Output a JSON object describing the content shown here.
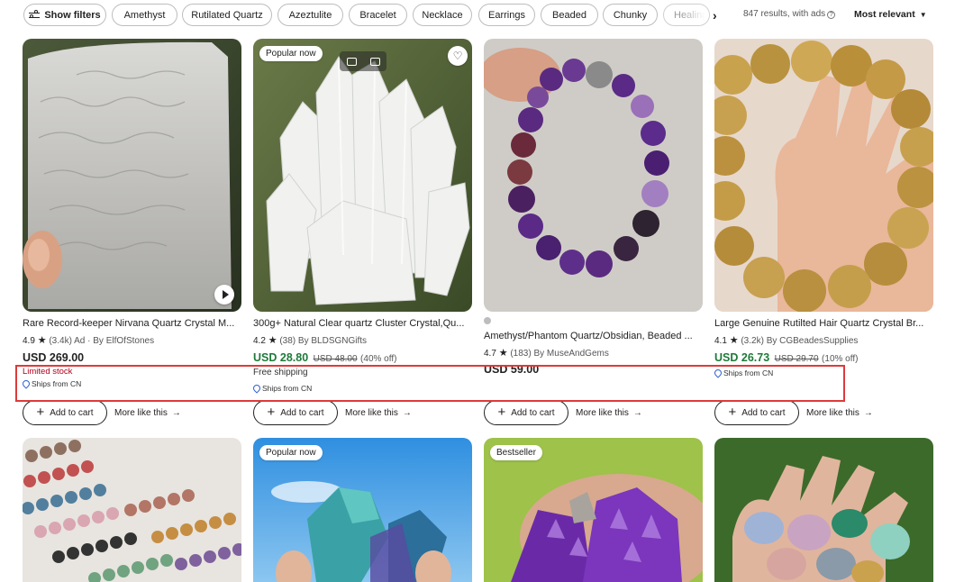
{
  "filters": {
    "show_filters": "Show filters",
    "chips": [
      "Amethyst",
      "Rutilated Quartz",
      "Azeztulite",
      "Bracelet",
      "Necklace",
      "Earrings",
      "Beaded",
      "Chunky",
      "Healing"
    ],
    "results": "847 results, with ads",
    "sort": "Most relevant"
  },
  "actions": {
    "add_to_cart": "Add to cart",
    "more_like_this": "More like this"
  },
  "listings": [
    {
      "title": "Rare Record-keeper Nirvana Quartz Crystal M...",
      "score": "4.9",
      "reviews": "(3.4k)",
      "ad": "Ad",
      "shop": "By ElfOfStones",
      "price": "USD 269.00",
      "note": "Limited stock",
      "ships": "Ships from CN"
    },
    {
      "badge": "Popular now",
      "title": "300g+ Natural Clear quartz Cluster Crystal,Qu...",
      "score": "4.2",
      "reviews": "(38)",
      "shop": "By BLDSGNGifts",
      "price": "USD 28.80",
      "original": "USD 48.00",
      "discount": "(40% off)",
      "note": "Free shipping",
      "ships": "Ships from CN"
    },
    {
      "title": "Amethyst/Phantom Quartz/Obsidian, Beaded ...",
      "score": "4.7",
      "reviews": "(183)",
      "shop": "By MuseAndGems",
      "price": "USD 59.00"
    },
    {
      "title": "Large Genuine Rutilted Hair Quartz Crystal Br...",
      "score": "4.1",
      "reviews": "(3.2k)",
      "shop": "By CGBeadesSupplies",
      "price": "USD 26.73",
      "original": "USD 29.70",
      "discount": "(10% off)",
      "ships": "Ships from CN"
    }
  ],
  "row2_badges": {
    "card2": "Popular now",
    "card3": "Bestseller"
  },
  "colors": {
    "sale_price": "#1f7a3a",
    "limited": "#b1001b",
    "highlight": "#de3a3a",
    "pin": "#2c5fd6"
  }
}
